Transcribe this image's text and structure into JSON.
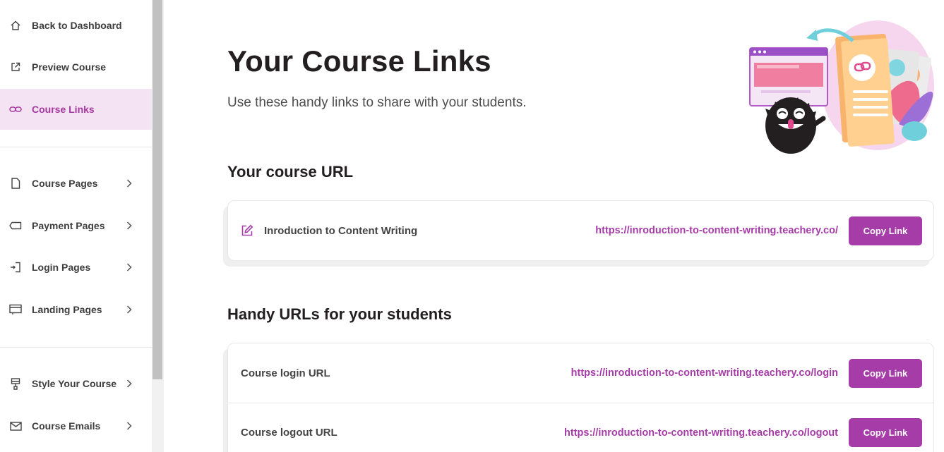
{
  "sidebar": {
    "items": [
      {
        "label": "Back to Dashboard",
        "icon": "home-icon"
      },
      {
        "label": "Preview Course",
        "icon": "external-link-icon"
      },
      {
        "label": "Course Links",
        "icon": "link-icon",
        "active": true
      },
      {
        "label": "Course Pages",
        "icon": "page-icon"
      },
      {
        "label": "Payment Pages",
        "icon": "tag-icon"
      },
      {
        "label": "Login Pages",
        "icon": "login-icon"
      },
      {
        "label": "Landing Pages",
        "icon": "landing-icon"
      },
      {
        "label": "Style Your Course",
        "icon": "paint-brush-icon"
      },
      {
        "label": "Course Emails",
        "icon": "mail-icon"
      }
    ]
  },
  "header": {
    "title": "Your Course Links",
    "subtitle": "Use these handy links to share with your students."
  },
  "course_url": {
    "heading": "Your course URL",
    "name": "Inroduction to Content Writing",
    "url": "https://inroduction-to-content-writing.teachery.co/",
    "button": "Copy Link"
  },
  "student_urls": {
    "heading": "Handy URLs for your students",
    "rows": [
      {
        "name": "Course login URL",
        "url": "https://inroduction-to-content-writing.teachery.co/login",
        "button": "Copy Link"
      },
      {
        "name": "Course logout URL",
        "url": "https://inroduction-to-content-writing.teachery.co/logout",
        "button": "Copy Link"
      }
    ]
  },
  "colors": {
    "accent": "#a63ca8",
    "active_bg": "#f3e3f3"
  }
}
